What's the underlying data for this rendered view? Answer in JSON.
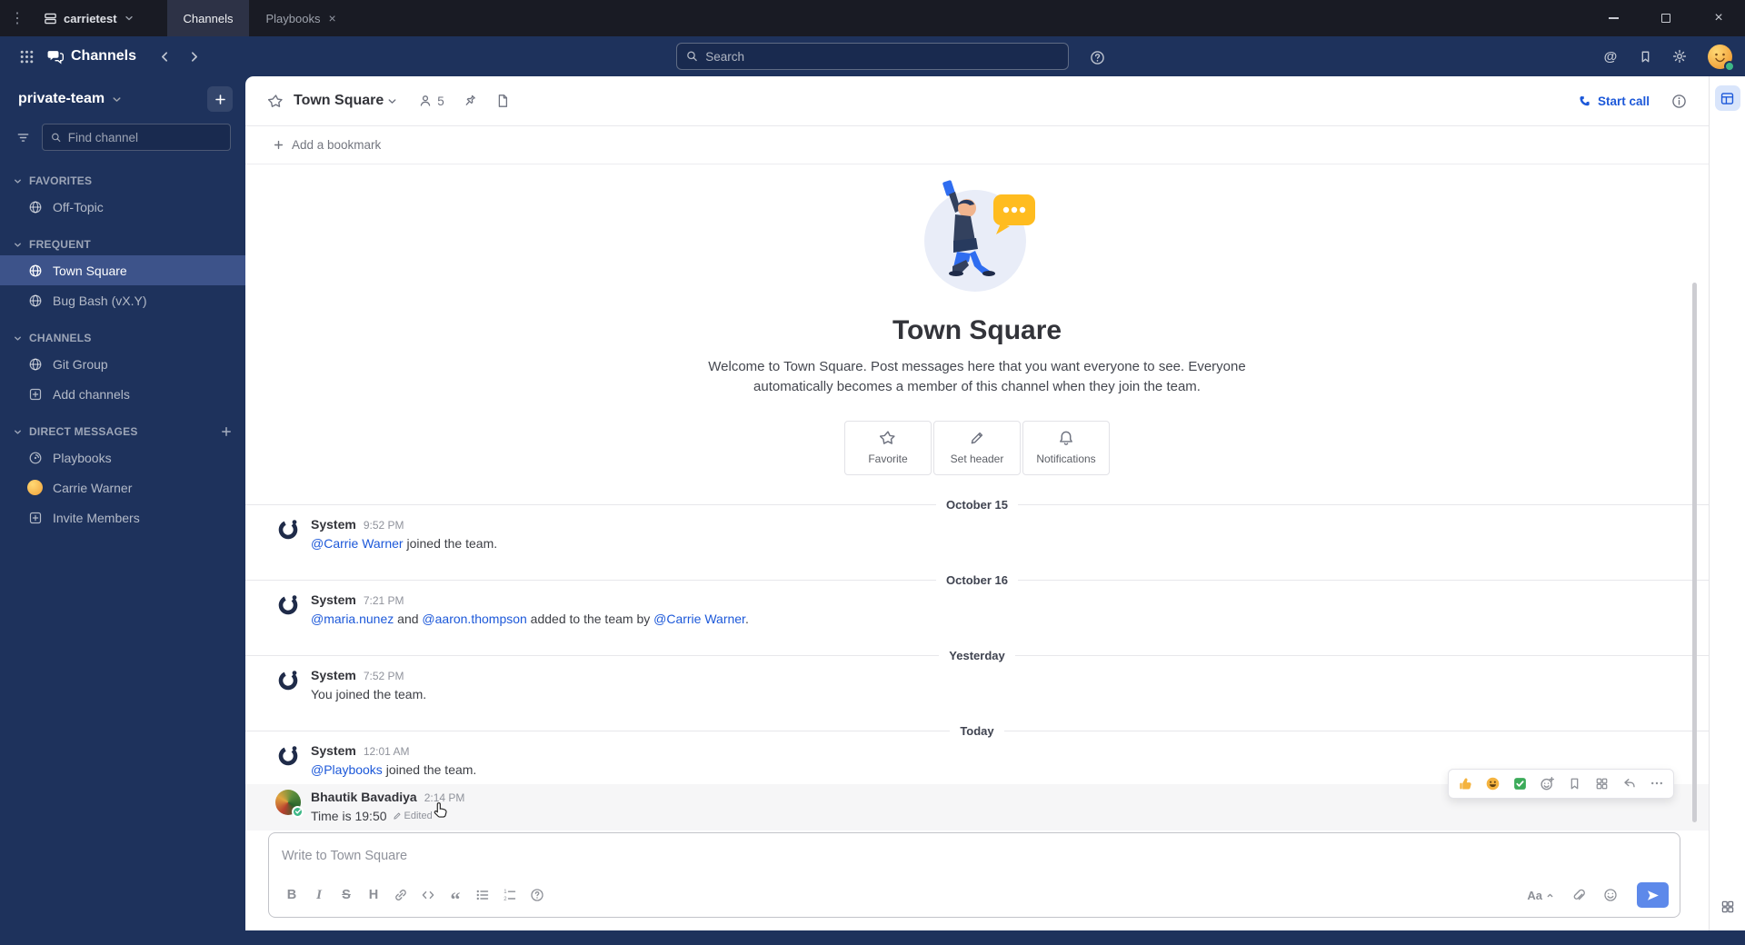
{
  "titlebar": {
    "team_menu": "carrietest",
    "tabs": [
      {
        "label": "Channels"
      },
      {
        "label": "Playbooks"
      }
    ]
  },
  "glyphs": {
    "menu_dots": "⋮",
    "close": "×",
    "at": "@",
    "quote": "“"
  },
  "global_header": {
    "product": "Channels",
    "search_placeholder": "Search"
  },
  "sidebar": {
    "team": "private-team",
    "find_placeholder": "Find channel",
    "sections": [
      {
        "label": "FAVORITES",
        "items": [
          {
            "label": "Off-Topic",
            "icon": "globe-icon"
          }
        ]
      },
      {
        "label": "FREQUENT",
        "items": [
          {
            "label": "Town Square",
            "icon": "globe-icon",
            "selected": true
          },
          {
            "label": "Bug Bash (vX.Y)",
            "icon": "globe-icon"
          }
        ]
      },
      {
        "label": "CHANNELS",
        "items": [
          {
            "label": "Git Group",
            "icon": "globe-icon"
          },
          {
            "label": "Add channels",
            "icon": "plus-box-icon"
          }
        ]
      },
      {
        "label": "DIRECT MESSAGES",
        "items": [
          {
            "label": "Playbooks",
            "icon": "playbooks-icon"
          },
          {
            "label": "Carrie Warner",
            "icon": "avatar"
          },
          {
            "label": "Invite Members",
            "icon": "plus-box-icon"
          }
        ]
      }
    ]
  },
  "channel_header": {
    "name": "Town Square",
    "member_count": "5",
    "start_call_label": "Start call",
    "icons": [
      "star-icon",
      "members-icon",
      "pin-icon",
      "files-icon",
      "phone-icon",
      "info-icon"
    ]
  },
  "bookmark_bar": {
    "label": "Add a bookmark"
  },
  "intro": {
    "title": "Town Square",
    "description": "Welcome to Town Square. Post messages here that you want everyone to see. Everyone automatically becomes a member of this channel when they join the team.",
    "actions": [
      {
        "label": "Favorite",
        "icon": "star-icon"
      },
      {
        "label": "Set header",
        "icon": "pencil-icon"
      },
      {
        "label": "Notifications",
        "icon": "bell-icon"
      }
    ]
  },
  "timeline": [
    {
      "type": "divider",
      "label": "October 15"
    },
    {
      "type": "message",
      "author": "System",
      "time": "9:52 PM",
      "segments": [
        {
          "text": "@Carrie Warner",
          "link": true
        },
        {
          "text": " joined the team.",
          "link": false
        }
      ]
    },
    {
      "type": "divider",
      "label": "October 16"
    },
    {
      "type": "message",
      "author": "System",
      "time": "7:21 PM",
      "segments": [
        {
          "text": "@maria.nunez",
          "link": true
        },
        {
          "text": " and ",
          "link": false
        },
        {
          "text": "@aaron.thompson",
          "link": true
        },
        {
          "text": " added to the team by ",
          "link": false
        },
        {
          "text": "@Carrie Warner",
          "link": true
        },
        {
          "text": ".",
          "link": false
        }
      ]
    },
    {
      "type": "divider",
      "label": "Yesterday"
    },
    {
      "type": "message",
      "author": "System",
      "time": "7:52 PM",
      "segments": [
        {
          "text": "You joined the team.",
          "link": false
        }
      ]
    },
    {
      "type": "divider",
      "label": "Today"
    },
    {
      "type": "message",
      "author": "System",
      "time": "12:01 AM",
      "segments": [
        {
          "text": "@Playbooks",
          "link": true
        },
        {
          "text": " joined the team.",
          "link": false
        }
      ]
    },
    {
      "type": "message",
      "author": "Bhautik Bavadiya",
      "time": "2:14 PM",
      "segments": [
        {
          "text": "Time is 19:50",
          "link": false
        }
      ],
      "edited_label": "Edited",
      "hovered": true
    }
  ],
  "message_hover_actions": [
    "thumbs-up-reaction",
    "grinning-reaction",
    "white-check-mark-reaction",
    "add-reaction",
    "save-message",
    "message-apps",
    "reply",
    "more-actions"
  ],
  "composer": {
    "placeholder": "Write to Town Square",
    "glyph_bold": "B",
    "glyph_italic": "I",
    "glyph_strike": "S",
    "glyph_heading": "H",
    "aa_label": "Aa",
    "format_buttons": [
      "bold",
      "italic",
      "strikethrough",
      "heading",
      "link",
      "code",
      "quote",
      "bulleted-list",
      "numbered-list",
      "help"
    ]
  },
  "app_bar_icons": [
    "table-app-icon",
    "apps-grid-icon"
  ]
}
